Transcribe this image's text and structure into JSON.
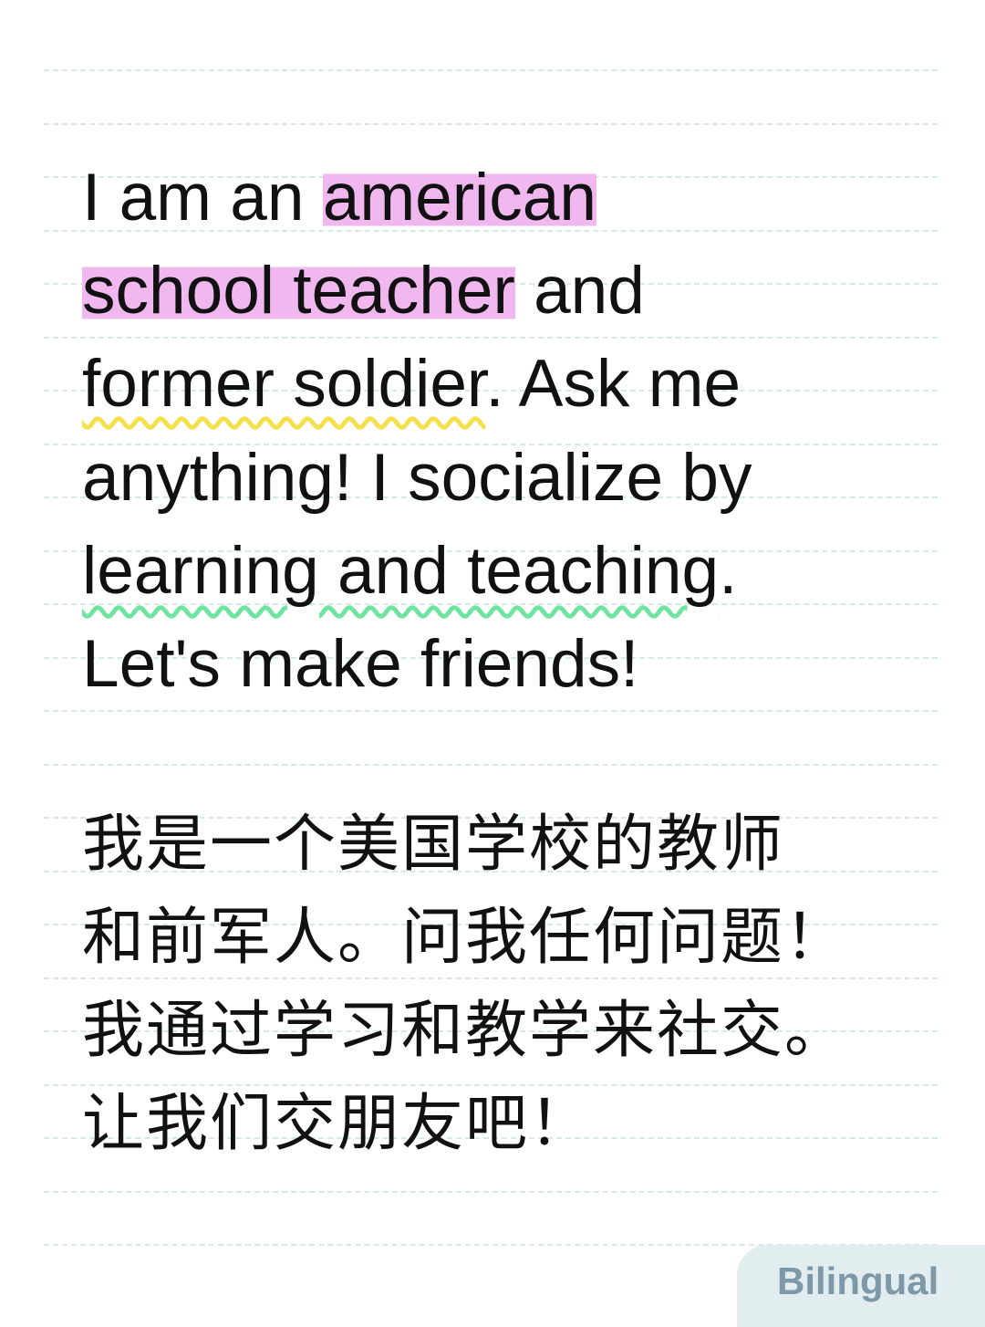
{
  "english": {
    "line1_pre": "I am an ",
    "line1_hl": "american",
    "line2_hl": "school teacher",
    "line2_post": " and",
    "line3_ul": "former soldier",
    "line3_post": ". Ask me",
    "line4": "anything! I socialize by",
    "line5_ul": "learning and teaching",
    "line5_post": ".",
    "line6": "Let's make friends!"
  },
  "chinese": {
    "lines": [
      "我是一个美国学校的教师",
      "和前军人。问我任何问题！",
      "我通过学习和教学来社交。",
      "让我们交朋友吧！"
    ]
  },
  "badge": {
    "label": "Bilingual"
  },
  "colors": {
    "highlight": "#f0b8ef",
    "yellow_underline": "#f5e04a",
    "green_underline": "#6fe3a0",
    "rule": "#d6e9e6",
    "badge_bg": "#e2edf0",
    "badge_text": "#7d98a7"
  }
}
